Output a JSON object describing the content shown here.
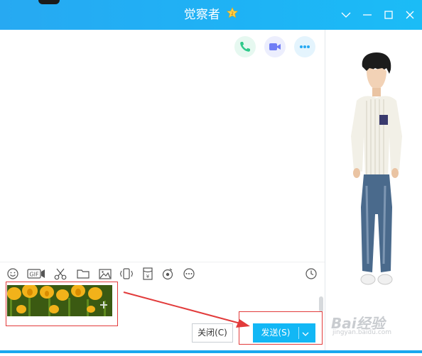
{
  "window": {
    "title": "觉察者",
    "badge_icon": "vip-star-icon",
    "controls": [
      "chevron-down-icon",
      "minimize-icon",
      "maximize-icon",
      "close-icon"
    ]
  },
  "header_actions": [
    {
      "name": "voice-call-icon",
      "color": "#2fc98a"
    },
    {
      "name": "video-call-icon",
      "color": "#6f7df5"
    },
    {
      "name": "more-icon",
      "color": "#27a9f2"
    }
  ],
  "toolbar": {
    "items": [
      "emoji-icon",
      "gif-icon",
      "scissors-icon",
      "folder-icon",
      "image-icon",
      "shake-icon",
      "red-packet-icon",
      "music-icon",
      "more-tools-icon"
    ],
    "right_item": "history-clock-icon"
  },
  "compose": {
    "attachment": "tulip-image"
  },
  "buttons": {
    "close_label": "关闭(C)",
    "send_label": "发送(S)"
  },
  "watermark": {
    "logo": "Bai经验",
    "url": "jingyan.baidu.com"
  },
  "colors": {
    "titlebar": "#1eb3f5",
    "send_button": "#12b7f5",
    "annotation": "#e23b3b"
  }
}
